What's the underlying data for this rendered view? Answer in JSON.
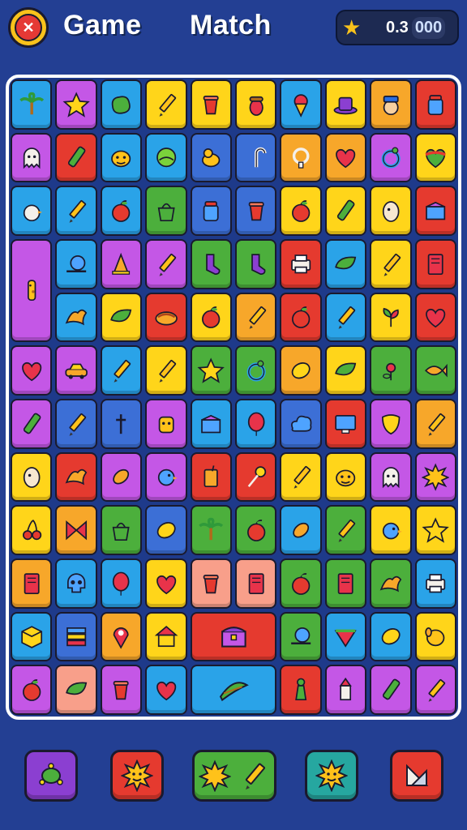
{
  "header": {
    "logo_icon": "game-logo-icon",
    "title_left": "Game",
    "title_right": "Match",
    "score_icon": "star-icon",
    "score_value": "0.3",
    "score_pill": "000"
  },
  "board": {
    "rows": 12,
    "cols": 10,
    "tiles": [
      {
        "r": 0,
        "c": 0,
        "color": "#2aa3e8",
        "icon": "palm-tree"
      },
      {
        "r": 0,
        "c": 1,
        "color": "#c457e6",
        "icon": "star"
      },
      {
        "r": 0,
        "c": 2,
        "color": "#2aa3e8",
        "icon": "blob"
      },
      {
        "r": 0,
        "c": 3,
        "color": "#ffd51a",
        "icon": "pencil"
      },
      {
        "r": 0,
        "c": 4,
        "color": "#ffd51a",
        "icon": "cup"
      },
      {
        "r": 0,
        "c": 5,
        "color": "#ffd51a",
        "icon": "acorn"
      },
      {
        "r": 0,
        "c": 6,
        "color": "#2aa3e8",
        "icon": "ice-cream"
      },
      {
        "r": 0,
        "c": 7,
        "color": "#ffd51a",
        "icon": "hat"
      },
      {
        "r": 0,
        "c": 8,
        "color": "#f7a72a",
        "icon": "gnome"
      },
      {
        "r": 0,
        "c": 9,
        "color": "#e53a2f",
        "icon": "jar"
      },
      {
        "r": 1,
        "c": 0,
        "color": "#c457e6",
        "icon": "ghost"
      },
      {
        "r": 1,
        "c": 1,
        "color": "#e53a2f",
        "icon": "crayon"
      },
      {
        "r": 1,
        "c": 2,
        "color": "#2aa3e8",
        "icon": "monster"
      },
      {
        "r": 1,
        "c": 3,
        "color": "#2aa3e8",
        "icon": "ball"
      },
      {
        "r": 1,
        "c": 4,
        "color": "#3c6fd6",
        "icon": "duck"
      },
      {
        "r": 1,
        "c": 5,
        "color": "#3c6fd6",
        "icon": "cane"
      },
      {
        "r": 1,
        "c": 6,
        "color": "#f7a72a",
        "icon": "pacifier"
      },
      {
        "r": 1,
        "c": 7,
        "color": "#f7a72a",
        "icon": "heart"
      },
      {
        "r": 1,
        "c": 8,
        "color": "#c457e6",
        "icon": "ring"
      },
      {
        "r": 1,
        "c": 9,
        "color": "#ffd51a",
        "icon": "rainbow-heart"
      },
      {
        "r": 2,
        "c": 0,
        "color": "#2aa3e8",
        "icon": "chick"
      },
      {
        "r": 2,
        "c": 1,
        "color": "#2aa3e8",
        "icon": "pencil"
      },
      {
        "r": 2,
        "c": 2,
        "color": "#2aa3e8",
        "icon": "apple"
      },
      {
        "r": 2,
        "c": 3,
        "color": "#4caf3c",
        "icon": "bag"
      },
      {
        "r": 2,
        "c": 4,
        "color": "#3c6fd6",
        "icon": "jar"
      },
      {
        "r": 2,
        "c": 5,
        "color": "#3c6fd6",
        "icon": "cup"
      },
      {
        "r": 2,
        "c": 6,
        "color": "#ffd51a",
        "icon": "apple"
      },
      {
        "r": 2,
        "c": 7,
        "color": "#ffd51a",
        "icon": "crayon"
      },
      {
        "r": 2,
        "c": 8,
        "color": "#ffd51a",
        "icon": "egg"
      },
      {
        "r": 2,
        "c": 9,
        "color": "#e53a2f",
        "icon": "box"
      },
      {
        "r": 3,
        "c": 0,
        "color": "#c457e6",
        "icon": "giraffe"
      },
      {
        "r": 3,
        "c": 1,
        "color": "#2aa3e8",
        "icon": "snail"
      },
      {
        "r": 3,
        "c": 2,
        "color": "#c457e6",
        "icon": "cone"
      },
      {
        "r": 3,
        "c": 3,
        "color": "#c457e6",
        "icon": "pencil"
      },
      {
        "r": 3,
        "c": 4,
        "color": "#4caf3c",
        "icon": "sock"
      },
      {
        "r": 3,
        "c": 5,
        "color": "#4caf3c",
        "icon": "sock"
      },
      {
        "r": 3,
        "c": 6,
        "color": "#e53a2f",
        "icon": "printer"
      },
      {
        "r": 3,
        "c": 7,
        "color": "#2aa3e8",
        "icon": "leaf"
      },
      {
        "r": 3,
        "c": 8,
        "color": "#ffd51a",
        "icon": "pencil"
      },
      {
        "r": 3,
        "c": 9,
        "color": "#e53a2f",
        "icon": "book"
      },
      {
        "r": 4,
        "c": 1,
        "color": "#2aa3e8",
        "icon": "dragon"
      },
      {
        "r": 4,
        "c": 2,
        "color": "#ffd51a",
        "icon": "leaf"
      },
      {
        "r": 4,
        "c": 3,
        "color": "#e53a2f",
        "icon": "pie"
      },
      {
        "r": 4,
        "c": 4,
        "color": "#ffd51a",
        "icon": "apple"
      },
      {
        "r": 4,
        "c": 5,
        "color": "#f7a72a",
        "icon": "pencil"
      },
      {
        "r": 4,
        "c": 6,
        "color": "#e53a2f",
        "icon": "apple"
      },
      {
        "r": 4,
        "c": 7,
        "color": "#2aa3e8",
        "icon": "pencil"
      },
      {
        "r": 4,
        "c": 8,
        "color": "#ffd51a",
        "icon": "plant"
      },
      {
        "r": 4,
        "c": 9,
        "color": "#e53a2f",
        "icon": "heart"
      },
      {
        "r": 5,
        "c": 0,
        "color": "#c457e6",
        "icon": "heart"
      },
      {
        "r": 5,
        "c": 1,
        "color": "#c457e6",
        "icon": "car"
      },
      {
        "r": 5,
        "c": 2,
        "color": "#2aa3e8",
        "icon": "pencil"
      },
      {
        "r": 5,
        "c": 3,
        "color": "#ffd51a",
        "icon": "pencil"
      },
      {
        "r": 5,
        "c": 4,
        "color": "#4caf3c",
        "icon": "star"
      },
      {
        "r": 5,
        "c": 5,
        "color": "#4caf3c",
        "icon": "ring"
      },
      {
        "r": 5,
        "c": 6,
        "color": "#f7a72a",
        "icon": "lemon"
      },
      {
        "r": 5,
        "c": 7,
        "color": "#ffd51a",
        "icon": "leaf"
      },
      {
        "r": 5,
        "c": 8,
        "color": "#4caf3c",
        "icon": "flower"
      },
      {
        "r": 5,
        "c": 9,
        "color": "#4caf3c",
        "icon": "fish"
      },
      {
        "r": 6,
        "c": 0,
        "color": "#c457e6",
        "icon": "crayon"
      },
      {
        "r": 6,
        "c": 1,
        "color": "#3c6fd6",
        "icon": "pencil"
      },
      {
        "r": 6,
        "c": 2,
        "color": "#3c6fd6",
        "icon": "cross"
      },
      {
        "r": 6,
        "c": 3,
        "color": "#c457e6",
        "icon": "robot"
      },
      {
        "r": 6,
        "c": 4,
        "color": "#2aa3e8",
        "icon": "box"
      },
      {
        "r": 6,
        "c": 5,
        "color": "#2aa3e8",
        "icon": "balloon"
      },
      {
        "r": 6,
        "c": 6,
        "color": "#3c6fd6",
        "icon": "cloud"
      },
      {
        "r": 6,
        "c": 7,
        "color": "#e53a2f",
        "icon": "monitor"
      },
      {
        "r": 6,
        "c": 8,
        "color": "#c457e6",
        "icon": "shield"
      },
      {
        "r": 6,
        "c": 9,
        "color": "#f7a72a",
        "icon": "pencil"
      },
      {
        "r": 7,
        "c": 0,
        "color": "#ffd51a",
        "icon": "egg"
      },
      {
        "r": 7,
        "c": 1,
        "color": "#e53a2f",
        "icon": "dragon"
      },
      {
        "r": 7,
        "c": 2,
        "color": "#c457e6",
        "icon": "seed"
      },
      {
        "r": 7,
        "c": 3,
        "color": "#c457e6",
        "icon": "bird"
      },
      {
        "r": 7,
        "c": 4,
        "color": "#e53a2f",
        "icon": "juice"
      },
      {
        "r": 7,
        "c": 5,
        "color": "#e53a2f",
        "icon": "lollipop"
      },
      {
        "r": 7,
        "c": 6,
        "color": "#ffd51a",
        "icon": "pencil"
      },
      {
        "r": 7,
        "c": 7,
        "color": "#ffd51a",
        "icon": "monster"
      },
      {
        "r": 7,
        "c": 8,
        "color": "#c457e6",
        "icon": "ghost"
      },
      {
        "r": 7,
        "c": 9,
        "color": "#c457e6",
        "icon": "sun"
      },
      {
        "r": 8,
        "c": 0,
        "color": "#ffd51a",
        "icon": "cherries"
      },
      {
        "r": 8,
        "c": 1,
        "color": "#f7a72a",
        "icon": "bow"
      },
      {
        "r": 8,
        "c": 2,
        "color": "#4caf3c",
        "icon": "bag"
      },
      {
        "r": 8,
        "c": 3,
        "color": "#3c6fd6",
        "icon": "lemon"
      },
      {
        "r": 8,
        "c": 4,
        "color": "#4caf3c",
        "icon": "palm-tree"
      },
      {
        "r": 8,
        "c": 5,
        "color": "#4caf3c",
        "icon": "apple"
      },
      {
        "r": 8,
        "c": 6,
        "color": "#2aa3e8",
        "icon": "seed"
      },
      {
        "r": 8,
        "c": 7,
        "color": "#4caf3c",
        "icon": "pencil"
      },
      {
        "r": 8,
        "c": 8,
        "color": "#ffd51a",
        "icon": "bird"
      },
      {
        "r": 8,
        "c": 9,
        "color": "#ffd51a",
        "icon": "star"
      },
      {
        "r": 9,
        "c": 0,
        "color": "#f7a72a",
        "icon": "book"
      },
      {
        "r": 9,
        "c": 1,
        "color": "#2aa3e8",
        "icon": "skull"
      },
      {
        "r": 9,
        "c": 2,
        "color": "#2aa3e8",
        "icon": "balloon"
      },
      {
        "r": 9,
        "c": 3,
        "color": "#ffd51a",
        "icon": "heart"
      },
      {
        "r": 9,
        "c": 4,
        "color": "#f89f8a",
        "icon": "cup"
      },
      {
        "r": 9,
        "c": 5,
        "color": "#f89f8a",
        "icon": "book"
      },
      {
        "r": 9,
        "c": 6,
        "color": "#4caf3c",
        "icon": "apple"
      },
      {
        "r": 9,
        "c": 7,
        "color": "#4caf3c",
        "icon": "book"
      },
      {
        "r": 9,
        "c": 8,
        "color": "#4caf3c",
        "icon": "dragon"
      },
      {
        "r": 9,
        "c": 9,
        "color": "#2aa3e8",
        "icon": "printer"
      },
      {
        "r": 10,
        "c": 0,
        "color": "#2aa3e8",
        "icon": "cube"
      },
      {
        "r": 10,
        "c": 1,
        "color": "#3c6fd6",
        "icon": "stack"
      },
      {
        "r": 10,
        "c": 2,
        "color": "#f7a72a",
        "icon": "pin"
      },
      {
        "r": 10,
        "c": 3,
        "color": "#ffd51a",
        "icon": "house"
      },
      {
        "r": 10,
        "c": 6,
        "color": "#4caf3c",
        "icon": "snail"
      },
      {
        "r": 10,
        "c": 7,
        "color": "#2aa3e8",
        "icon": "watermelon"
      },
      {
        "r": 10,
        "c": 8,
        "color": "#2aa3e8",
        "icon": "lemon"
      },
      {
        "r": 10,
        "c": 9,
        "color": "#ffd51a",
        "icon": "dog"
      },
      {
        "r": 11,
        "c": 0,
        "color": "#c457e6",
        "icon": "apple"
      },
      {
        "r": 11,
        "c": 1,
        "color": "#f89f8a",
        "icon": "leaf"
      },
      {
        "r": 11,
        "c": 2,
        "color": "#c457e6",
        "icon": "cup"
      },
      {
        "r": 11,
        "c": 3,
        "color": "#2aa3e8",
        "icon": "heart"
      },
      {
        "r": 11,
        "c": 5,
        "color": "#e53a2f",
        "icon": "pencil"
      },
      {
        "r": 11,
        "c": 6,
        "color": "#e53a2f",
        "icon": "pawn"
      },
      {
        "r": 11,
        "c": 7,
        "color": "#c457e6",
        "icon": "rocket"
      },
      {
        "r": 11,
        "c": 8,
        "color": "#c457e6",
        "icon": "crayon"
      },
      {
        "r": 11,
        "c": 9,
        "color": "#c457e6",
        "icon": "pencil"
      }
    ],
    "large_tiles": [
      {
        "r": 3,
        "c": 0,
        "rows": 2,
        "cols": 1,
        "color": "#c457e6",
        "icon": "giraffe"
      },
      {
        "r": 10,
        "c": 4,
        "rows": 1,
        "cols": 2,
        "color": "#e53a2f",
        "icon": "chest"
      },
      {
        "r": 11,
        "c": 4,
        "rows": 1,
        "cols": 2,
        "color": "#2aa3e8",
        "icon": "banana"
      }
    ]
  },
  "bottom_buttons": [
    {
      "name": "turtle-button",
      "color": "#8b3fd1",
      "icons": [
        "turtle"
      ]
    },
    {
      "name": "sun-face-button",
      "color": "#e53a2f",
      "icons": [
        "sun-face"
      ]
    },
    {
      "name": "star-pencil-button",
      "color": "#4caf3c",
      "icons": [
        "sun",
        "pencil"
      ]
    },
    {
      "name": "sun-button",
      "color": "#26a7a0",
      "icons": [
        "sun-face"
      ]
    },
    {
      "name": "eraser-button",
      "color": "#e53a2f",
      "icons": [
        "eraser"
      ]
    }
  ]
}
